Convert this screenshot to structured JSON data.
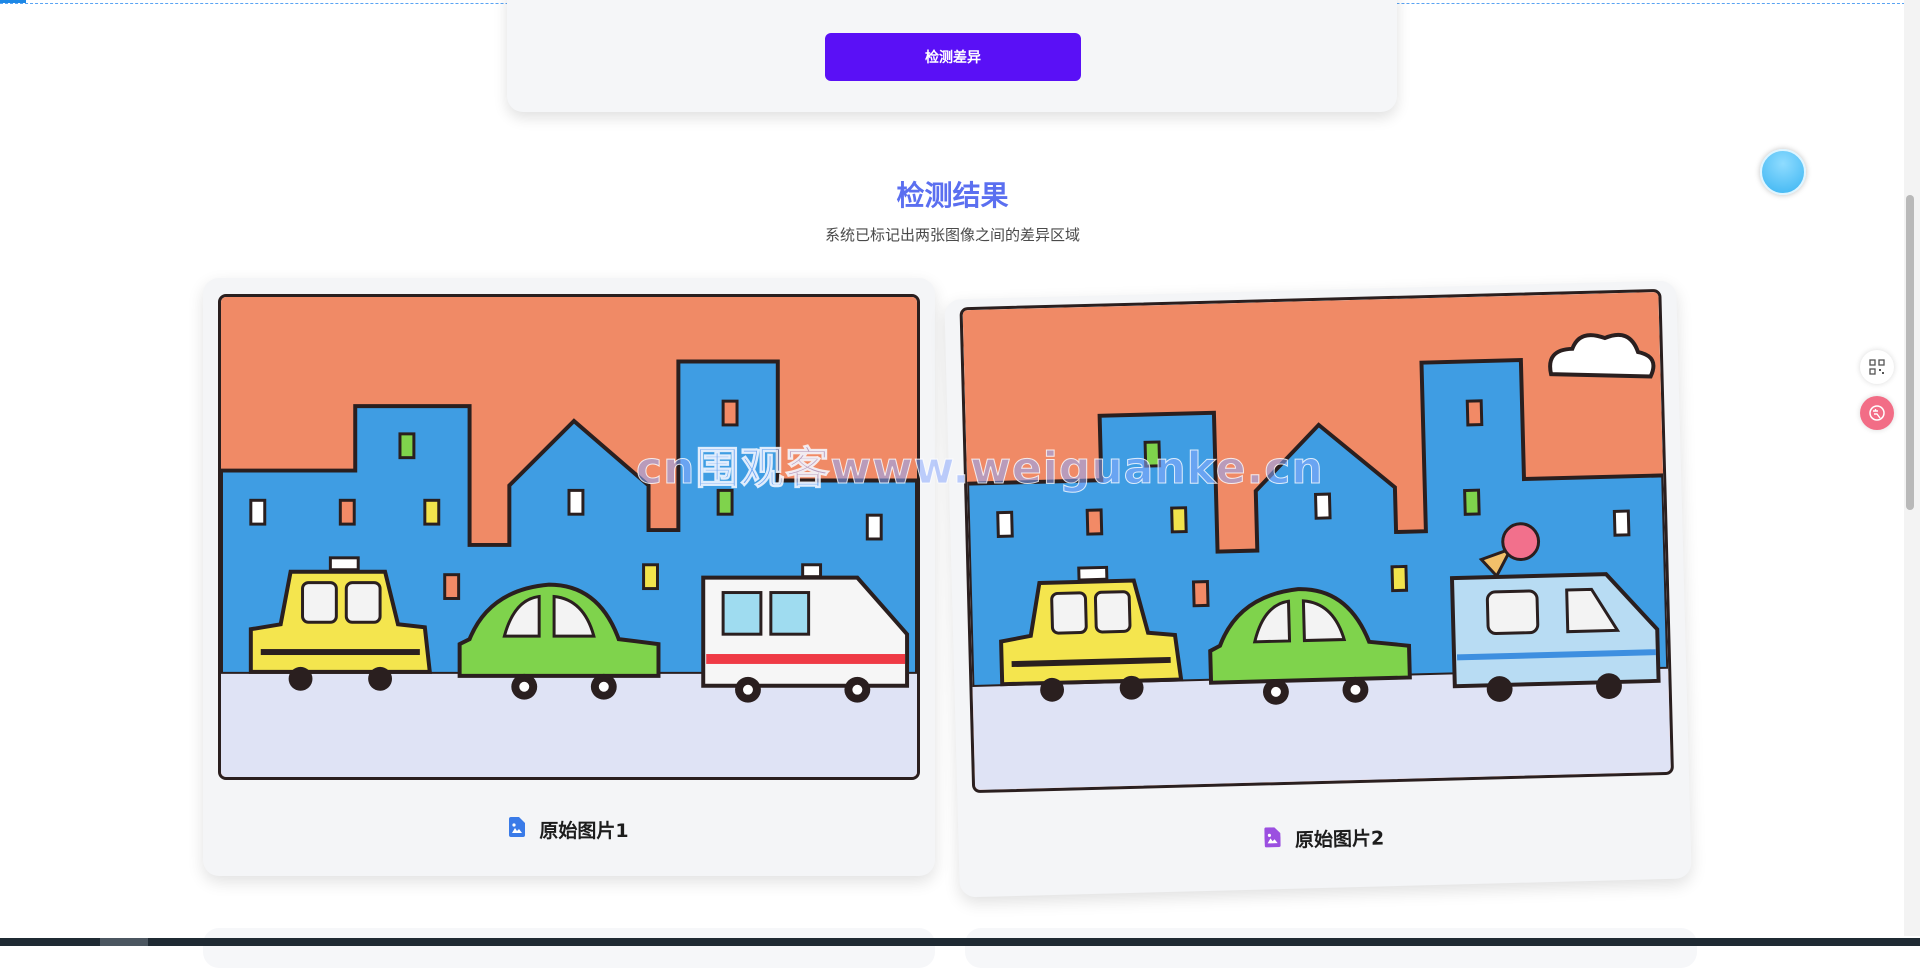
{
  "toolbar": {
    "detect_button_label": "检测差异"
  },
  "results": {
    "title": "检测结果",
    "subtitle": "系统已标记出两张图像之间的差异区域",
    "images": [
      {
        "caption": "原始图片1",
        "icon": "image-file-icon",
        "icon_color": "#3a7be8"
      },
      {
        "caption": "原始图片2",
        "icon": "image-file-icon",
        "icon_color": "#9b4fe0"
      }
    ]
  },
  "watermark": "cn围观客www.weiguanke.cn",
  "colors": {
    "accent_button": "#5a10f6",
    "title": "#5b6ff0",
    "sky": "#f28a63",
    "buildings": "#3f9de3"
  }
}
